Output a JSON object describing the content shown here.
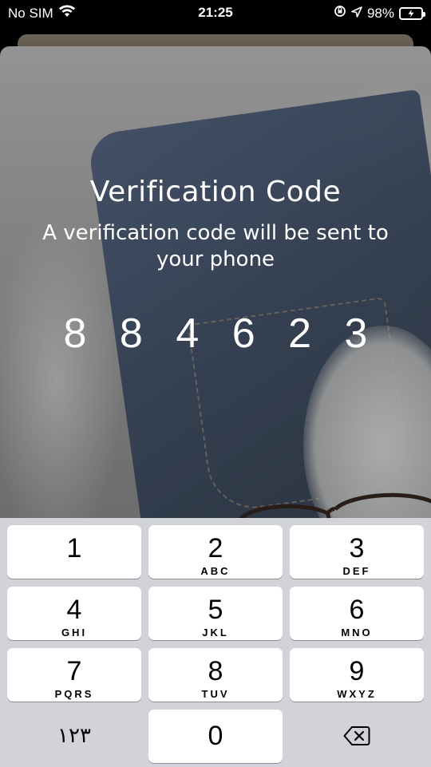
{
  "status_bar": {
    "carrier": "No SIM",
    "time": "21:25",
    "battery_percent": "98%",
    "battery_level": 0.98,
    "battery_color": "#34c759",
    "icons": [
      "wifi-icon",
      "screen-rotation-lock-icon",
      "location-arrow-icon",
      "battery-charging-icon"
    ]
  },
  "screen": {
    "title": "Verification Code",
    "subtitle": "A verification code will be sent to your phone",
    "code_digits": [
      "8",
      "8",
      "4",
      "6",
      "2",
      "3"
    ]
  },
  "keypad": {
    "keys": [
      {
        "digit": "1",
        "letters": ""
      },
      {
        "digit": "2",
        "letters": "ABC"
      },
      {
        "digit": "3",
        "letters": "DEF"
      },
      {
        "digit": "4",
        "letters": "GHI"
      },
      {
        "digit": "5",
        "letters": "JKL"
      },
      {
        "digit": "6",
        "letters": "MNO"
      },
      {
        "digit": "7",
        "letters": "PQRS"
      },
      {
        "digit": "8",
        "letters": "TUV"
      },
      {
        "digit": "9",
        "letters": "WXYZ"
      }
    ],
    "alt_numerals_label": "١٢٣",
    "zero": "0",
    "delete_icon": "backspace-icon"
  }
}
